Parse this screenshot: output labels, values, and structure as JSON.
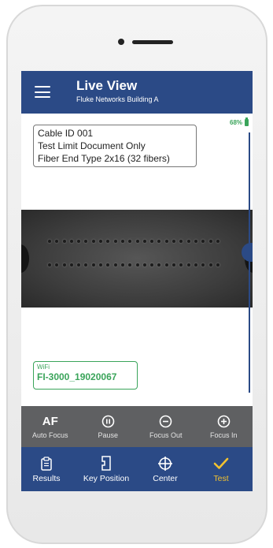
{
  "header": {
    "title": "Live View",
    "subtitle": "Fluke Networks Building A",
    "menu_icon": "hamburger-menu-icon"
  },
  "battery": {
    "percent_label": "68%",
    "color": "#3aa45a"
  },
  "info": {
    "cable_id": "Cable ID 001",
    "test_limit": "Test Limit Document Only",
    "fiber_end_type": "Fiber End Type 2x16 (32 fibers)"
  },
  "wifi": {
    "label": "WiFi",
    "network": "FI-3000_19020067"
  },
  "focus_slider": {
    "level_fraction": 0.47
  },
  "focus_controls": [
    {
      "label": "Auto Focus",
      "icon_text": "AF"
    },
    {
      "label": "Pause",
      "icon": "pause-icon"
    },
    {
      "label": "Focus Out",
      "icon": "minus-circle-icon"
    },
    {
      "label": "Focus In",
      "icon": "plus-circle-icon"
    }
  ],
  "nav": [
    {
      "label": "Results",
      "icon": "clipboard-icon"
    },
    {
      "label": "Key Position",
      "icon": "key-position-icon"
    },
    {
      "label": "Center",
      "icon": "crosshair-icon"
    },
    {
      "label": "Test",
      "icon": "checkmark-icon",
      "color": "#f2c230"
    }
  ],
  "colors": {
    "primary": "#2b4a86",
    "accent_green": "#3aa45a",
    "accent_gold": "#f2c230",
    "toolbar_gray": "#5f6062"
  }
}
